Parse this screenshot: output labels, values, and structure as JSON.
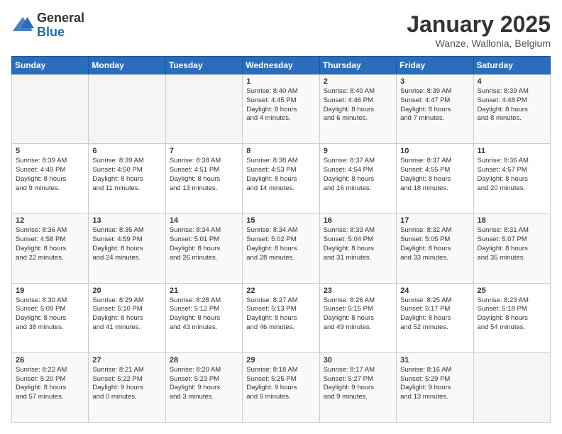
{
  "logo": {
    "general": "General",
    "blue": "Blue"
  },
  "title": "January 2025",
  "location": "Wanze, Wallonia, Belgium",
  "days_of_week": [
    "Sunday",
    "Monday",
    "Tuesday",
    "Wednesday",
    "Thursday",
    "Friday",
    "Saturday"
  ],
  "weeks": [
    [
      {
        "day": "",
        "info": ""
      },
      {
        "day": "",
        "info": ""
      },
      {
        "day": "",
        "info": ""
      },
      {
        "day": "1",
        "info": "Sunrise: 8:40 AM\nSunset: 4:45 PM\nDaylight: 8 hours\nand 4 minutes."
      },
      {
        "day": "2",
        "info": "Sunrise: 8:40 AM\nSunset: 4:46 PM\nDaylight: 8 hours\nand 6 minutes."
      },
      {
        "day": "3",
        "info": "Sunrise: 8:39 AM\nSunset: 4:47 PM\nDaylight: 8 hours\nand 7 minutes."
      },
      {
        "day": "4",
        "info": "Sunrise: 8:39 AM\nSunset: 4:48 PM\nDaylight: 8 hours\nand 8 minutes."
      }
    ],
    [
      {
        "day": "5",
        "info": "Sunrise: 8:39 AM\nSunset: 4:49 PM\nDaylight: 8 hours\nand 9 minutes."
      },
      {
        "day": "6",
        "info": "Sunrise: 8:39 AM\nSunset: 4:50 PM\nDaylight: 8 hours\nand 11 minutes."
      },
      {
        "day": "7",
        "info": "Sunrise: 8:38 AM\nSunset: 4:51 PM\nDaylight: 8 hours\nand 13 minutes."
      },
      {
        "day": "8",
        "info": "Sunrise: 8:38 AM\nSunset: 4:53 PM\nDaylight: 8 hours\nand 14 minutes."
      },
      {
        "day": "9",
        "info": "Sunrise: 8:37 AM\nSunset: 4:54 PM\nDaylight: 8 hours\nand 16 minutes."
      },
      {
        "day": "10",
        "info": "Sunrise: 8:37 AM\nSunset: 4:55 PM\nDaylight: 8 hours\nand 18 minutes."
      },
      {
        "day": "11",
        "info": "Sunrise: 8:36 AM\nSunset: 4:57 PM\nDaylight: 8 hours\nand 20 minutes."
      }
    ],
    [
      {
        "day": "12",
        "info": "Sunrise: 8:36 AM\nSunset: 4:58 PM\nDaylight: 8 hours\nand 22 minutes."
      },
      {
        "day": "13",
        "info": "Sunrise: 8:35 AM\nSunset: 4:59 PM\nDaylight: 8 hours\nand 24 minutes."
      },
      {
        "day": "14",
        "info": "Sunrise: 8:34 AM\nSunset: 5:01 PM\nDaylight: 8 hours\nand 26 minutes."
      },
      {
        "day": "15",
        "info": "Sunrise: 8:34 AM\nSunset: 5:02 PM\nDaylight: 8 hours\nand 28 minutes."
      },
      {
        "day": "16",
        "info": "Sunrise: 8:33 AM\nSunset: 5:04 PM\nDaylight: 8 hours\nand 31 minutes."
      },
      {
        "day": "17",
        "info": "Sunrise: 8:32 AM\nSunset: 5:05 PM\nDaylight: 8 hours\nand 33 minutes."
      },
      {
        "day": "18",
        "info": "Sunrise: 8:31 AM\nSunset: 5:07 PM\nDaylight: 8 hours\nand 35 minutes."
      }
    ],
    [
      {
        "day": "19",
        "info": "Sunrise: 8:30 AM\nSunset: 5:09 PM\nDaylight: 8 hours\nand 38 minutes."
      },
      {
        "day": "20",
        "info": "Sunrise: 8:29 AM\nSunset: 5:10 PM\nDaylight: 8 hours\nand 41 minutes."
      },
      {
        "day": "21",
        "info": "Sunrise: 8:28 AM\nSunset: 5:12 PM\nDaylight: 8 hours\nand 43 minutes."
      },
      {
        "day": "22",
        "info": "Sunrise: 8:27 AM\nSunset: 5:13 PM\nDaylight: 8 hours\nand 46 minutes."
      },
      {
        "day": "23",
        "info": "Sunrise: 8:26 AM\nSunset: 5:15 PM\nDaylight: 8 hours\nand 49 minutes."
      },
      {
        "day": "24",
        "info": "Sunrise: 8:25 AM\nSunset: 5:17 PM\nDaylight: 8 hours\nand 52 minutes."
      },
      {
        "day": "25",
        "info": "Sunrise: 8:23 AM\nSunset: 5:18 PM\nDaylight: 8 hours\nand 54 minutes."
      }
    ],
    [
      {
        "day": "26",
        "info": "Sunrise: 8:22 AM\nSunset: 5:20 PM\nDaylight: 8 hours\nand 57 minutes."
      },
      {
        "day": "27",
        "info": "Sunrise: 8:21 AM\nSunset: 5:22 PM\nDaylight: 9 hours\nand 0 minutes."
      },
      {
        "day": "28",
        "info": "Sunrise: 8:20 AM\nSunset: 5:23 PM\nDaylight: 9 hours\nand 3 minutes."
      },
      {
        "day": "29",
        "info": "Sunrise: 8:18 AM\nSunset: 5:25 PM\nDaylight: 9 hours\nand 6 minutes."
      },
      {
        "day": "30",
        "info": "Sunrise: 8:17 AM\nSunset: 5:27 PM\nDaylight: 9 hours\nand 9 minutes."
      },
      {
        "day": "31",
        "info": "Sunrise: 8:16 AM\nSunset: 5:29 PM\nDaylight: 9 hours\nand 13 minutes."
      },
      {
        "day": "",
        "info": ""
      }
    ]
  ]
}
